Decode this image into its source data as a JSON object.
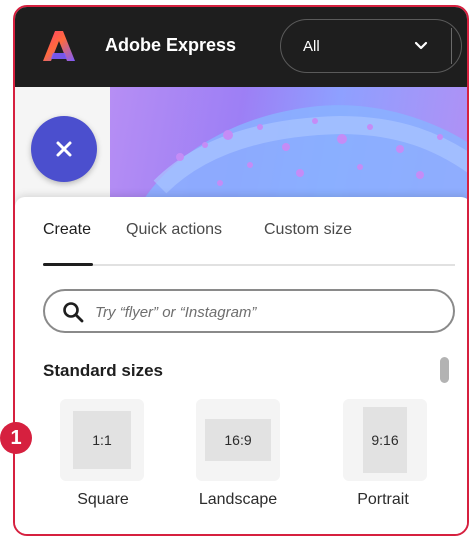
{
  "header": {
    "app_title": "Adobe Express",
    "logo_icon": "adobe-express-logo",
    "scope_select": {
      "value": "All",
      "icon": "chevron-down-icon"
    }
  },
  "close_button": {
    "icon": "close-icon"
  },
  "tabs": [
    {
      "label": "Create",
      "active": true
    },
    {
      "label": "Quick actions",
      "active": false
    },
    {
      "label": "Custom size",
      "active": false
    }
  ],
  "search": {
    "placeholder": "Try “flyer” or “Instagram”",
    "value": "",
    "icon": "search-icon"
  },
  "standard_sizes": {
    "title": "Standard sizes",
    "items": [
      {
        "ratio": "1:1",
        "label": "Square"
      },
      {
        "ratio": "16:9",
        "label": "Landscape"
      },
      {
        "ratio": "9:16",
        "label": "Portrait"
      }
    ]
  },
  "callout": {
    "number": "1"
  },
  "colors": {
    "accent_red": "#d6203f",
    "close_button": "#4b4fce",
    "topbar": "#1e1e1e"
  }
}
